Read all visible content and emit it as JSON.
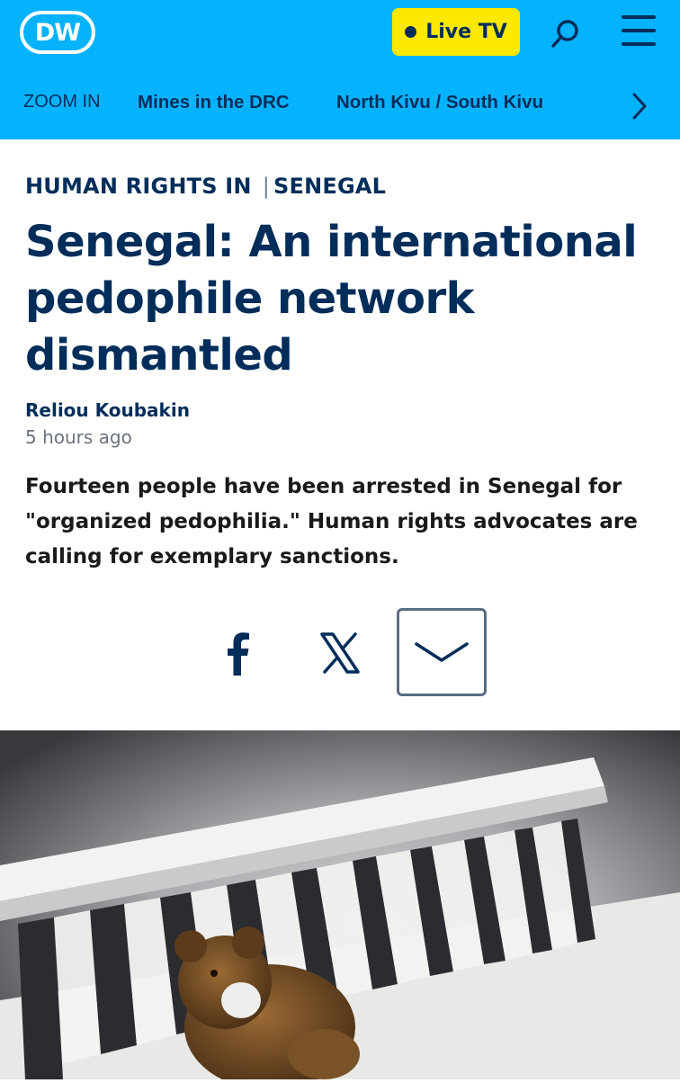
{
  "header": {
    "logo_text": "DW",
    "live_button_label": "Live TV",
    "search_icon": "search-icon",
    "menu_icon": "hamburger-menu-icon"
  },
  "nav": {
    "zoom_label": "ZOOM IN",
    "items": [
      "Mines in the DRC",
      "North Kivu / South Kivu"
    ],
    "next_icon": "chevron-right-icon"
  },
  "article": {
    "kicker": "HUMAN RIGHTS IN",
    "kicker_topic": "SENEGAL",
    "headline": "Senegal: An international pedophile network dismantled",
    "author": "Reliou Koubakin",
    "timestamp": "5 hours ago",
    "teaser": "Fourteen people have been arrested in Senegal for \"organized pedophilia.\" Human rights advocates are calling for exemplary sanctions."
  },
  "share": {
    "facebook_icon": "facebook-icon",
    "x_icon": "x-twitter-icon",
    "more_icon": "chevron-down-icon"
  },
  "hero": {
    "subject": "teddy-bear-in-crib-photo"
  },
  "colors": {
    "brand_blue": "#05b2fc",
    "navy": "#002d5a",
    "live_yellow": "#fde800"
  }
}
